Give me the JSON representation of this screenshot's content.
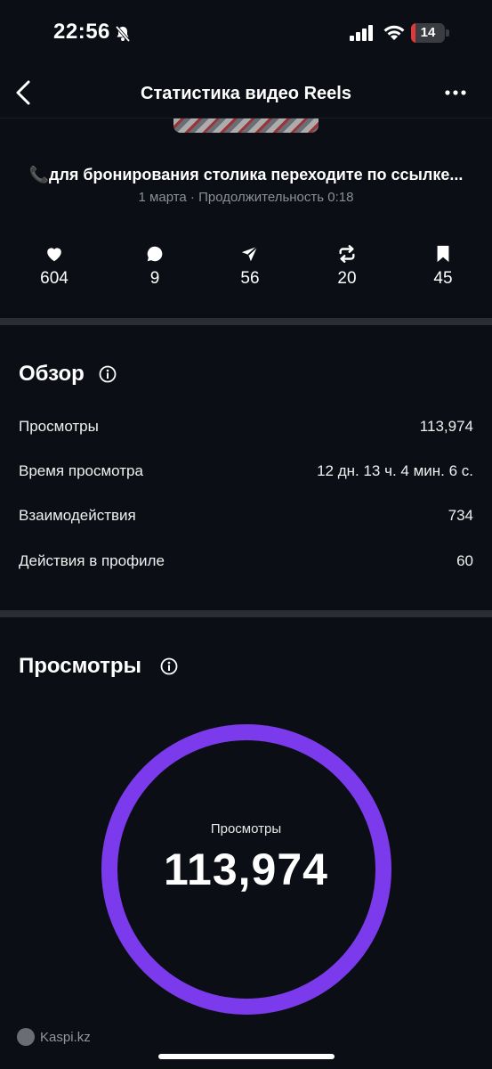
{
  "status_bar": {
    "time": "22:56",
    "battery": "14",
    "battery_level": 0.14
  },
  "header": {
    "title": "Статистика видео Reels"
  },
  "post": {
    "caption": "📞для бронирования столика переходите по ссылке...",
    "meta": "1 марта · Продолжительность 0:18"
  },
  "stats": [
    {
      "icon": "heart-icon",
      "value": "604"
    },
    {
      "icon": "comment-icon",
      "value": "9"
    },
    {
      "icon": "share-icon",
      "value": "56"
    },
    {
      "icon": "repost-icon",
      "value": "20"
    },
    {
      "icon": "bookmark-icon",
      "value": "45"
    }
  ],
  "overview": {
    "title": "Обзор",
    "rows": [
      {
        "label": "Просмотры",
        "value": "113,974"
      },
      {
        "label": "Время просмотра",
        "value": "12 дн. 13 ч. 4 мин. 6 с."
      },
      {
        "label": "Взаимодействия",
        "value": "734"
      },
      {
        "label": "Действия в профиле",
        "value": "60"
      }
    ]
  },
  "views": {
    "title": "Просмотры",
    "ring_label": "Просмотры",
    "ring_value": "113,974",
    "ring_fraction": 1.0
  },
  "watermark": "Kaspi.kz",
  "colors": {
    "accent": "#7c3aed",
    "background": "#0b0e14",
    "battery_low": "#e0393b"
  }
}
